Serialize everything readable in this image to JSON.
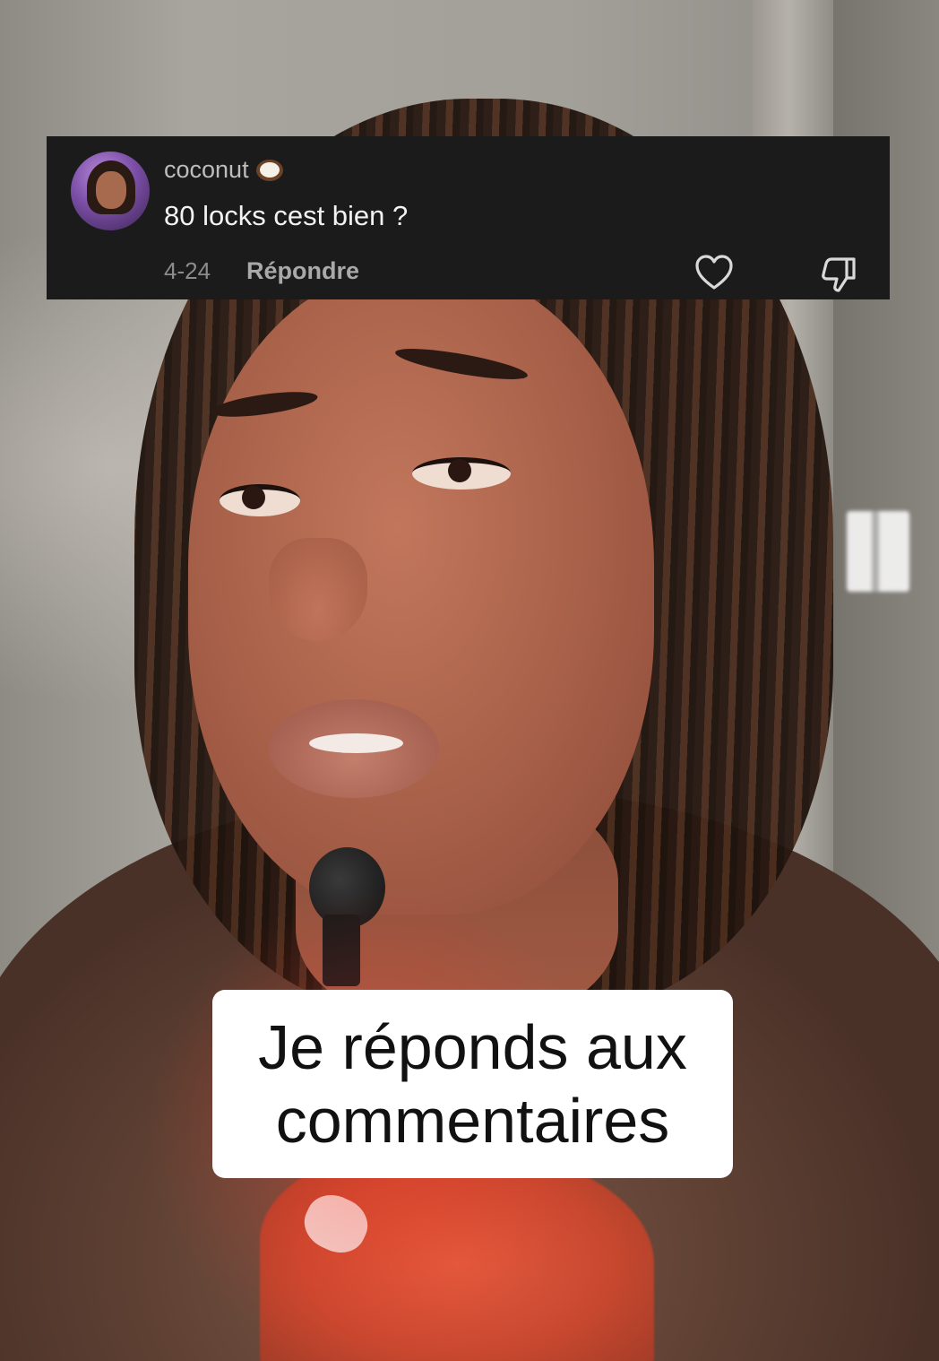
{
  "comment": {
    "username": "coconut",
    "username_emoji": "coconut-icon",
    "text": "80 locks cest bien ?",
    "date": "4-24",
    "reply_label": "Répondre",
    "like_icon": "heart-outline-icon",
    "dislike_icon": "thumbs-down-outline-icon"
  },
  "caption": {
    "line1": "Je réponds aux",
    "line2": "commentaires"
  },
  "colors": {
    "comment_bg": "#1b1b1b",
    "username": "#bdbdbd",
    "comment_text": "#f2f2f2",
    "meta_text": "#8c8c8c",
    "caption_bg": "#ffffff",
    "caption_text": "#111111"
  }
}
